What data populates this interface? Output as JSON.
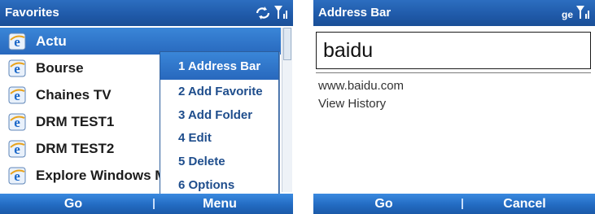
{
  "left_screen": {
    "title": "Favorites",
    "favorites": [
      {
        "label": "Actu",
        "selected": true
      },
      {
        "label": "Bourse",
        "selected": false
      },
      {
        "label": "Chaines TV",
        "selected": false
      },
      {
        "label": "DRM TEST1",
        "selected": false
      },
      {
        "label": "DRM TEST2",
        "selected": false
      },
      {
        "label": "Explore Windows Mo",
        "selected": false
      }
    ],
    "menu": [
      {
        "label": "1 Address Bar",
        "active": true
      },
      {
        "label": "2 Add Favorite",
        "active": false
      },
      {
        "label": "3 Add Folder",
        "active": false
      },
      {
        "label": "4 Edit",
        "active": false
      },
      {
        "label": "5 Delete",
        "active": false
      },
      {
        "label": "6 Options",
        "active": false
      }
    ],
    "softkeys": {
      "left": "Go",
      "right": "Menu"
    }
  },
  "right_screen": {
    "title": "Address Bar",
    "status_text": "ge",
    "address_value": "baidu",
    "suggestions": [
      "www.baidu.com",
      "View History"
    ],
    "softkeys": {
      "left": "Go",
      "right": "Cancel"
    }
  },
  "colors": {
    "title_bar": "#1f59a8",
    "selection": "#2f76cc",
    "menu_text": "#1e4d8c",
    "softkey_bar": "#236bc2"
  },
  "icons": [
    "internet-explorer-icon",
    "sync-icon",
    "signal-strength-icon"
  ]
}
